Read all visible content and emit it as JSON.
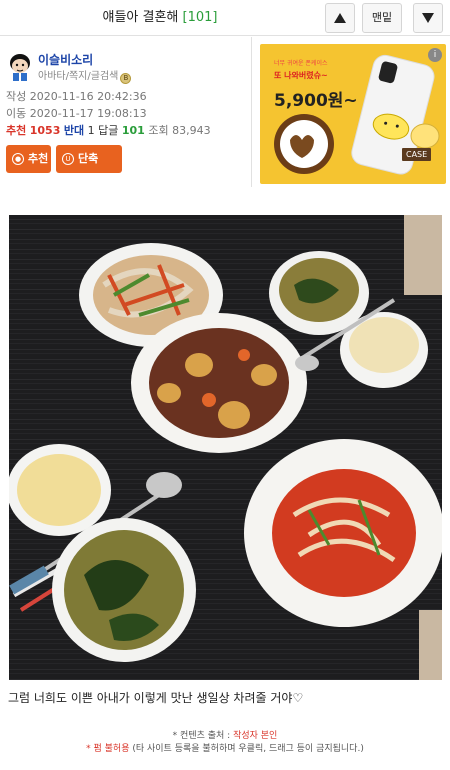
{
  "header": {
    "title": "얘들아 결혼해",
    "count": "[101]",
    "up_icon": "triangle-up-icon",
    "bottom_label": "맨밑",
    "down_icon": "triangle-down-icon"
  },
  "post": {
    "author": "이슬비소리",
    "author_links": "아바타/쪽지/글검색",
    "written_label": "작성",
    "written": "2020-11-16 20:42:36",
    "moved_label": "이동",
    "moved": "2020-11-17 19:08:13",
    "stats": {
      "recommend_label": "추천",
      "recommend": "1053",
      "oppose_label": "반대",
      "oppose": "1",
      "reply_label": "답글",
      "reply": "101",
      "views_label": "조회",
      "views": "83,943"
    },
    "recommend_button": "추천",
    "shorturl_button": "단축URL"
  },
  "ad": {
    "line1": "너무 귀여운 폰케이스",
    "line2": "또 나와버렸슈~",
    "price": "5,900원~",
    "tag": "CASE",
    "colors": {
      "background": "#f5c430"
    }
  },
  "content": {
    "caption": "그럼 너희도 이쁜 아내가 이렇게 맛난 생일상 차려줄 거야♡",
    "source_prefix": "* 컨텐츠 출처 : ",
    "source_value": "작성자 본인",
    "notice_prefix": "* 펌 불허용",
    "notice_rest": " (타 사이트 등록을 불허하며 우클릭, 드래그 등이 금지됩니다.)"
  },
  "colors": {
    "accent_orange": "#e8621f",
    "link_blue": "#1d45a8",
    "green": "#2a9d3a",
    "red": "#d9352a"
  }
}
